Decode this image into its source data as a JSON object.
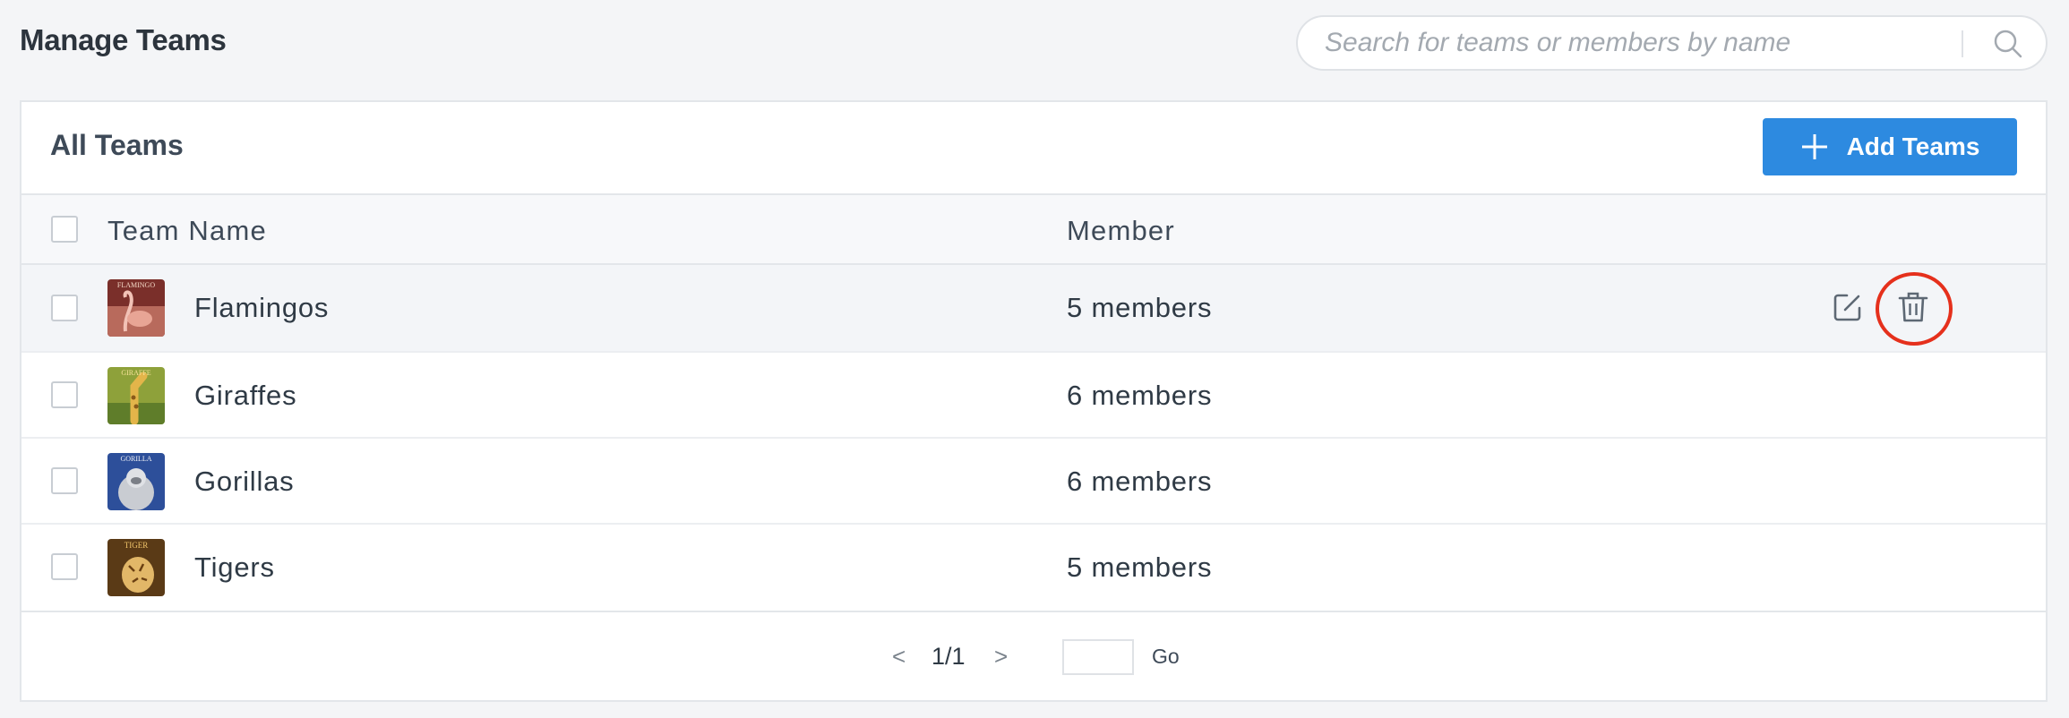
{
  "page": {
    "title": "Manage Teams"
  },
  "search": {
    "placeholder": "Search for teams or members by name",
    "value": ""
  },
  "card": {
    "title": "All Teams",
    "add_button_label": "Add Teams"
  },
  "table": {
    "columns": [
      "Team Name",
      "Member"
    ],
    "rows": [
      {
        "name": "Flamingos",
        "members": "5 members",
        "avatar_text": "FLAMINGO"
      },
      {
        "name": "Giraffes",
        "members": "6 members",
        "avatar_text": "GIRAFFE"
      },
      {
        "name": "Gorillas",
        "members": "6 members",
        "avatar_text": "GORILLA"
      },
      {
        "name": "Tigers",
        "members": "5 members",
        "avatar_text": "TIGER"
      }
    ],
    "row_actions_icons": [
      "edit-icon",
      "trash-icon"
    ]
  },
  "pagination": {
    "prev": "<",
    "page": "1/1",
    "next": ">",
    "go_label": "Go",
    "jump_value": ""
  },
  "colors": {
    "accent": "#2d8ae0",
    "highlight": "#e5301c",
    "background": "#f4f5f7"
  }
}
